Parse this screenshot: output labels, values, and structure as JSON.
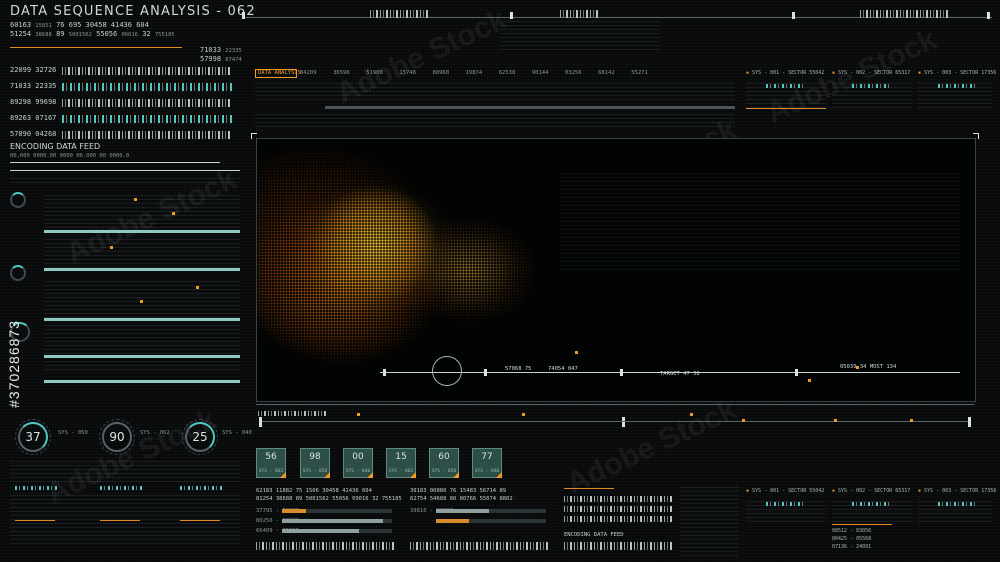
{
  "title": "DATA SEQUENCE ANALYSIS - 062",
  "header_numbers": {
    "row1": [
      "60163",
      "15851",
      "76",
      "695",
      "30458",
      "41436",
      "604"
    ],
    "row2": [
      "51254",
      "38688",
      "89",
      "5001562",
      "55056",
      "06016",
      "32",
      "755185"
    ],
    "right_a": [
      "71033",
      "22335"
    ],
    "right_b": [
      "57998",
      "87474"
    ]
  },
  "left_rows": [
    [
      "22099",
      "32726"
    ],
    [
      "71033",
      "22335"
    ],
    [
      "89298",
      "99698"
    ],
    [
      "89263",
      "07167"
    ],
    [
      "57890",
      "04268"
    ]
  ],
  "encoding_feed_label": "ENCODING DATA FEED",
  "encoding_feed_sub": "00,000 0000.00  0000 00.000  00 0000.0",
  "top_strip_label": "DATA ANALYSIS",
  "top_strip_codes": [
    "84209",
    "36596",
    "51908",
    "15748",
    "80960",
    "19874",
    "62538",
    "90144",
    "03256",
    "68142",
    "55271"
  ],
  "sectors_top": [
    "SYS - 001 - SECTOR 55042",
    "SYS - 002 - SECTOR 65317",
    "SYS - 003 - SECTOR 17356"
  ],
  "sectors_bottom": [
    "SYS - 001 - SECTOR 55042",
    "SYS - 002 - SECTOR 65317",
    "SYS - 003 - SECTOR 17356"
  ],
  "viewport_readouts": {
    "left": "57068",
    "left_val": "75",
    "mid": "74054",
    "mid_val": "047",
    "right_a": "TARGET",
    "right_b": "47",
    "right_c": "58",
    "far_a": "05039",
    "far_b": "34",
    "far_c": "MOST",
    "far_d": "134"
  },
  "gauges": [
    {
      "value": "37",
      "label": "SYS - 050"
    },
    {
      "value": "90",
      "label": "SYS - 062"
    },
    {
      "value": "25",
      "label": "SYS - 040"
    }
  ],
  "tiles": [
    {
      "value": "56",
      "label": "SYS - 062"
    },
    {
      "value": "98",
      "label": "SYS - 050"
    },
    {
      "value": "00",
      "label": "SYS - 040"
    },
    {
      "value": "15",
      "label": "SYS - 062"
    },
    {
      "value": "60",
      "label": "SYS - 050"
    },
    {
      "value": "77",
      "label": "SYS - 040"
    }
  ],
  "bottom_codes_left": [
    [
      "62183",
      "11882",
      "75",
      "1506",
      "30458",
      "41436",
      "604"
    ],
    [
      "81254",
      "38688",
      "89",
      "5001562",
      "55056",
      "09016",
      "32",
      "755185"
    ]
  ],
  "bottom_codes_mid": [
    [
      "39183",
      "00880",
      "76",
      "15483",
      "56714",
      "89"
    ],
    [
      "62754",
      "54688",
      "80",
      "80766",
      "55074",
      "8802"
    ]
  ],
  "bottom_progress_labels": [
    "37795 - 58226",
    "80250 - 38320",
    "66409 - 85685",
    "39810 - 03310"
  ],
  "bottom_encoding_label": "ENCODING DATA FEED",
  "bottom_right_codes": [
    "08512 - 83056",
    "80425 - 05568",
    "07136 - 24091"
  ],
  "colors": {
    "accent_orange": "#f29a26",
    "accent_teal": "#4fc7c0",
    "panel_border": "#39454a",
    "background": "#07090a"
  },
  "watermark": "Adobe Stock",
  "vertical_id": "#370286873"
}
